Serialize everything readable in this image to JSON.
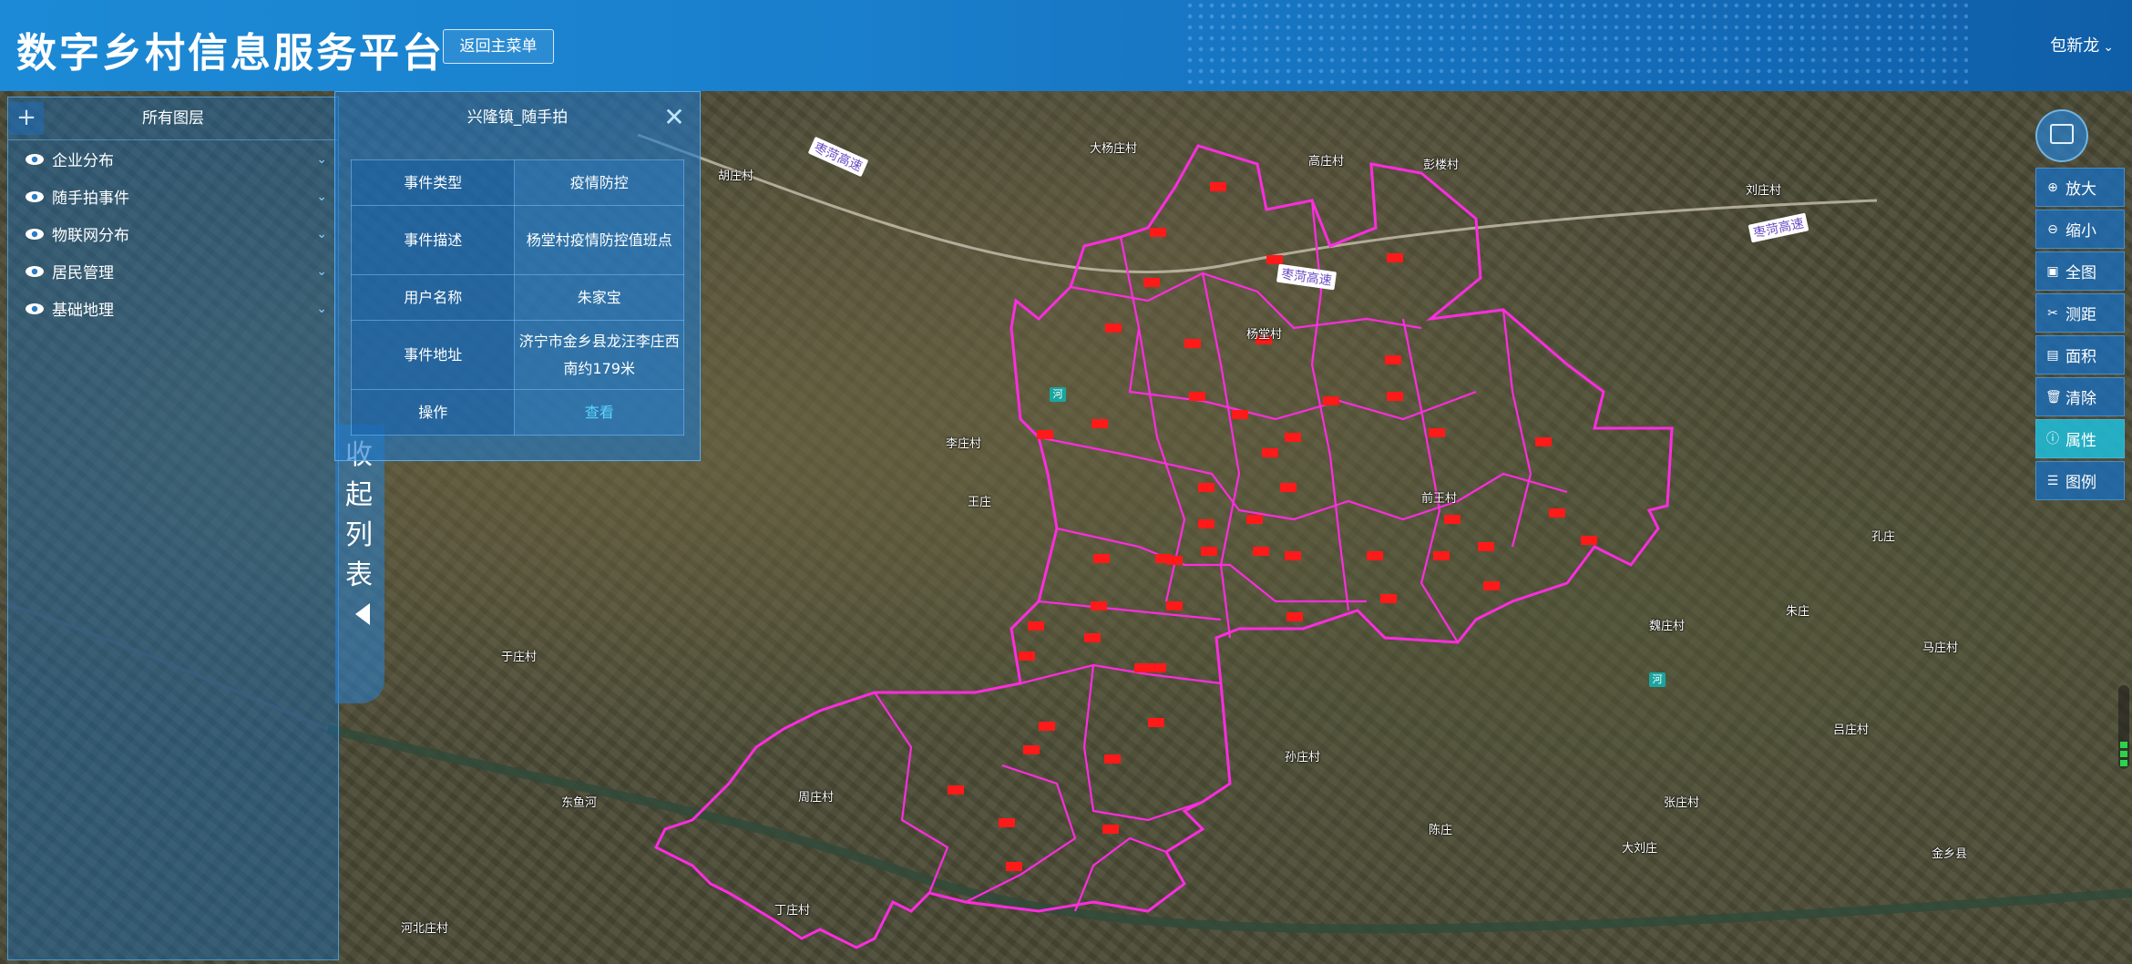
{
  "header": {
    "title": "数字乡村信息服务平台",
    "back_label": "返回主菜单",
    "user_name": "包新龙"
  },
  "layer_panel": {
    "title": "所有图层",
    "items": [
      {
        "label": "企业分布"
      },
      {
        "label": "随手拍事件"
      },
      {
        "label": "物联网分布"
      },
      {
        "label": "居民管理"
      },
      {
        "label": "基础地理"
      }
    ]
  },
  "collapse_tab": {
    "label": "收起列表"
  },
  "popup": {
    "title": "兴隆镇_随手拍",
    "rows": [
      {
        "key": "事件类型",
        "value": "疫情防控"
      },
      {
        "key": "事件描述",
        "value": "杨堂村疫情防控值班点"
      },
      {
        "key": "用户名称",
        "value": "朱家宝"
      },
      {
        "key": "事件地址",
        "value": "济宁市金乡县龙汪李庄西南约179米"
      }
    ],
    "action_key": "操作",
    "action_label": "查看"
  },
  "toolbar": {
    "buttons": [
      {
        "label": "放大",
        "icon": "zoom-in-icon"
      },
      {
        "label": "缩小",
        "icon": "zoom-out-icon"
      },
      {
        "label": "全图",
        "icon": "full-extent-icon"
      },
      {
        "label": "测距",
        "icon": "measure-distance-icon"
      },
      {
        "label": "面积",
        "icon": "measure-area-icon"
      },
      {
        "label": "清除",
        "icon": "trash-icon"
      },
      {
        "label": "属性",
        "icon": "info-icon",
        "active": true
      },
      {
        "label": "图例",
        "icon": "legend-icon"
      }
    ]
  },
  "map": {
    "road_labels": [
      "枣菏高速",
      "枣菏高速",
      "枣菏高速"
    ],
    "village_labels": [
      "大杨庄村",
      "高庄村",
      "彭楼村",
      "胡庄村",
      "刘庄村",
      "王庄",
      "于庄村",
      "李庄村",
      "前王村",
      "魏庄村",
      "朱庄",
      "吕庄村",
      "张庄村",
      "孙庄村",
      "杨堂村",
      "孔庄",
      "周庄村",
      "陈庄",
      "马庄村",
      "金乡县",
      "东鱼河",
      "河北庄村",
      "大刘庄",
      "丁庄村"
    ],
    "boundary_color": "#ff2ce0",
    "marker_color": "#ff1a1a"
  }
}
